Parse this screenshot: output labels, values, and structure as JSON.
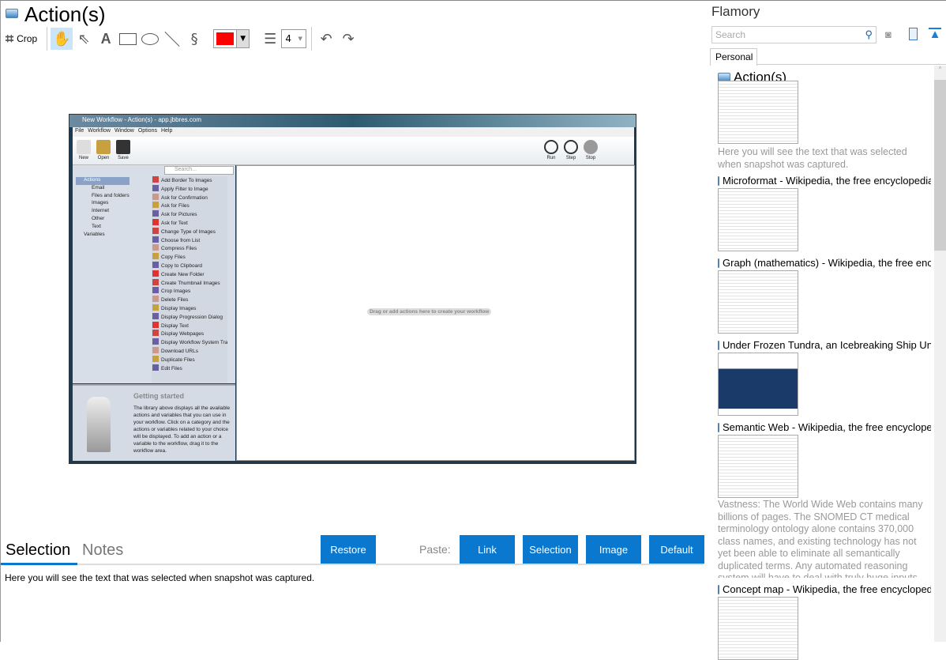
{
  "header": {
    "title": "Action(s)"
  },
  "toolbar": {
    "crop_label": "Crop",
    "line_width": "4",
    "color": "#ff0000"
  },
  "screenshot": {
    "window_title": "New Workflow - Action(s) - app.jbbres.com",
    "menu": [
      "File",
      "Workflow",
      "Window",
      "Options",
      "Help"
    ],
    "buttons_left": [
      "New",
      "Open",
      "Save"
    ],
    "buttons_right": [
      "Run",
      "Step",
      "Stop"
    ],
    "search_placeholder": "Search...",
    "categories": [
      "Actions",
      "Email",
      "Files and folders",
      "Images",
      "Internet",
      "Other",
      "Text",
      "Variables"
    ],
    "actions": [
      "Add Border To Images",
      "Apply Filter to Image",
      "Ask for Confirmation",
      "Ask for Files",
      "Ask for Pictures",
      "Ask for Text",
      "Change Type of Images",
      "Choose from List",
      "Compress Files",
      "Copy Files",
      "Copy to Clipboard",
      "Create New Folder",
      "Create Thumbnail Images",
      "Crop Images",
      "Delete Files",
      "Display Images",
      "Display Progression Dialog",
      "Display Text",
      "Display Webpages",
      "Display Workflow System Tra",
      "Download URLs",
      "Duplicate Files",
      "Edit Files"
    ],
    "getting_started_title": "Getting started",
    "getting_started_text": "The library above displays all the available actions and variables that you can use in your workflow. Click on a category and the actions or variables related to your choice will be displayed. To add an action or a variable to the workflow, drag it to the workflow area.",
    "workflow_hint": "Drag or add actions here to create your workflow"
  },
  "bottom": {
    "tabs": [
      "Selection",
      "Notes"
    ],
    "restore": "Restore",
    "paste_label": "Paste:",
    "paste_buttons": [
      "Link",
      "Selection",
      "Image",
      "Default"
    ],
    "selection_text": "Here you will see the text that was selected when snapshot was captured.",
    "accent": "#0a78cf"
  },
  "sidebar": {
    "title": "Flamory",
    "search_placeholder": "Search",
    "tab": "Personal",
    "items": [
      {
        "title": "Action(s)",
        "desc": "Here you will see the text that was selected when snapshot was captured."
      },
      {
        "title": "Microformat - Wikipedia, the free encyclopedia"
      },
      {
        "title": "Graph (mathematics) - Wikipedia, the free encyclopedia"
      },
      {
        "title": "Under Frozen Tundra, an Icebreaking Ship Uncovers"
      },
      {
        "title": "Semantic Web - Wikipedia, the free encyclopedia",
        "desc": "Vastness: The World Wide Web contains many billions of pages. The SNOMED CT medical terminology ontology alone contains 370,000 class names, and existing technology has not yet been able to eliminate all semantically duplicated terms. Any automated reasoning system will have to deal with truly huge inputs."
      },
      {
        "title": "Concept map - Wikipedia, the free encyclopedia"
      }
    ]
  }
}
